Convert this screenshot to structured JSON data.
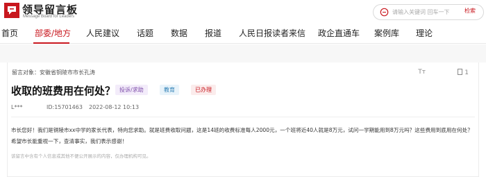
{
  "header": {
    "logo_title": "领导留言板",
    "logo_subtitle": "Message Board for Leaders",
    "search_placeholder": "请输入关键词 回车一下",
    "search_button": "检索"
  },
  "nav": {
    "items": [
      {
        "label": "首页",
        "active": false
      },
      {
        "label": "部委/地方",
        "active": true
      },
      {
        "label": "人民建议",
        "active": false
      },
      {
        "label": "话题",
        "active": false
      },
      {
        "label": "数据",
        "active": false
      },
      {
        "label": "报道",
        "active": false
      },
      {
        "label": "人民日报读者来信",
        "active": false
      },
      {
        "label": "政企直通车",
        "active": false
      },
      {
        "label": "案例库",
        "active": false
      },
      {
        "label": "理论",
        "active": false
      }
    ]
  },
  "message": {
    "target": "留言对象：安徽省铜陵市市长孔涛",
    "font_tool": "Tт",
    "like_count": "1",
    "title": "收取的班费用在何处？",
    "tags": {
      "category": "投诉/求助",
      "domain": "教育",
      "status": "已办理"
    },
    "author": "L***",
    "id": "ID:15701463",
    "date": "2022-08-12 10:13",
    "body": "市长您好！我们是铜陵市xx中学的家长代表，特向您求助。就是班费收取问题，这是14班的收费标准每人2000元，一个班将近40人就是8万元，试问一学期能用到8万元吗？这些费用到底用在何处？希望市长能重视一下，查清事实，我们表示感谢！",
    "disclaimer": "该留言中含有个人信息或其他不便公开展示的内容，仅办理机构可见。"
  },
  "colors": {
    "accent": "#c8171e",
    "tag_complaint_bg": "#f3ecfa",
    "tag_edu_bg": "#e8f3fa",
    "tag_done_bg": "#fbecec"
  },
  "icons": {
    "logo": "message-board-logo-icon",
    "search": "search-icon",
    "font_size": "font-size-icon",
    "like": "like-icon"
  }
}
